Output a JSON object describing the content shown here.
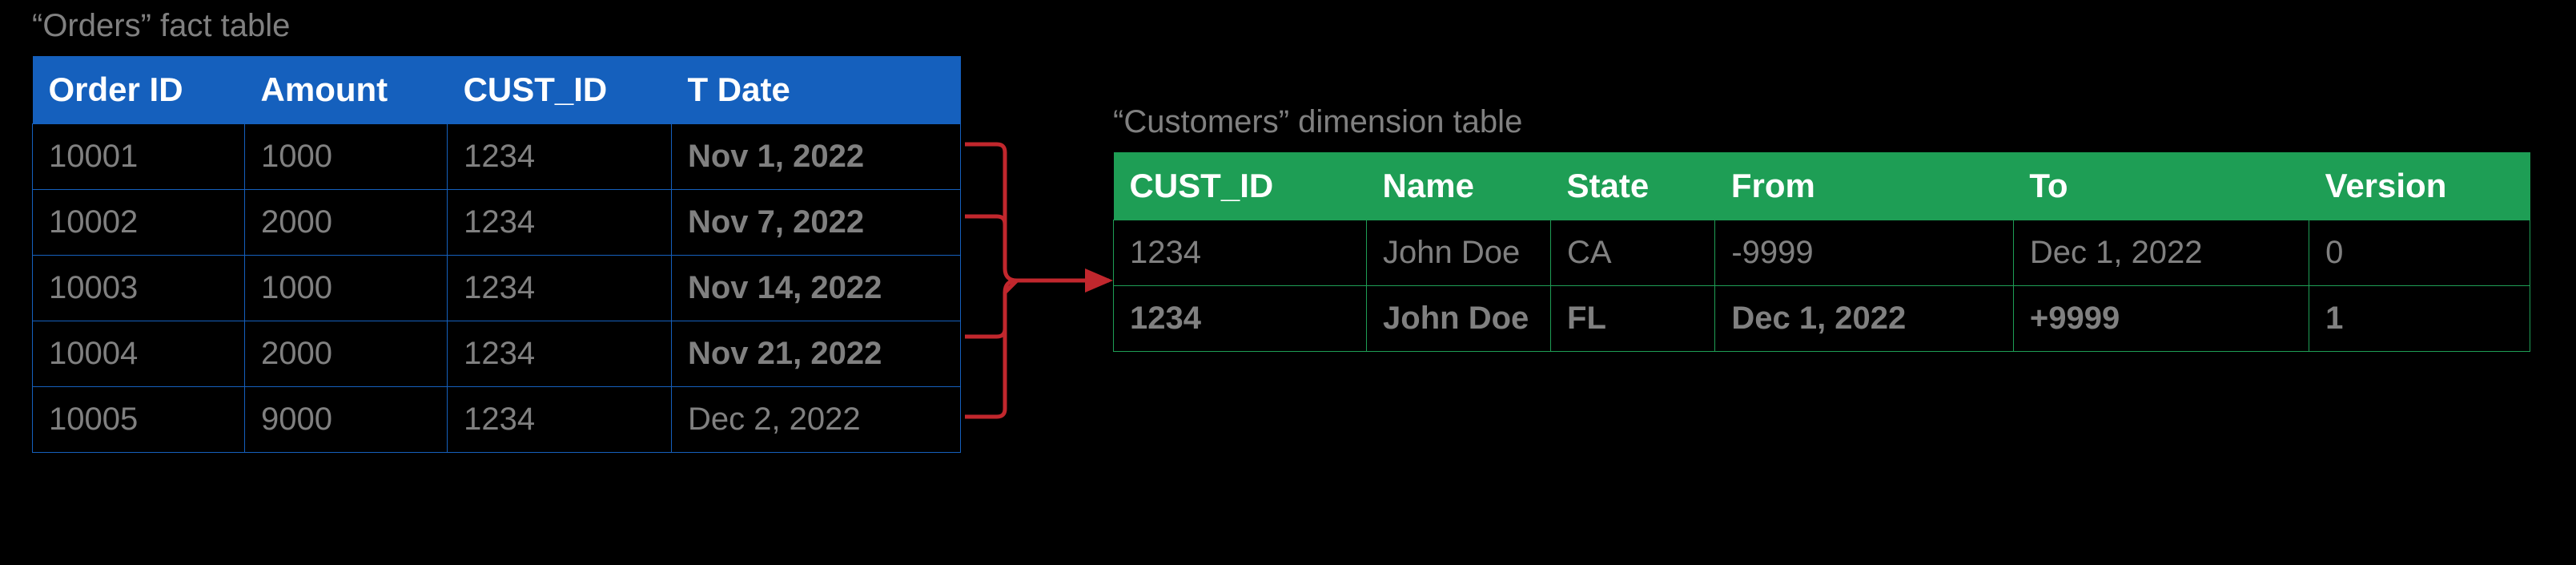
{
  "fact": {
    "caption": "“Orders” fact table",
    "columns": [
      "Order ID",
      "Amount",
      "CUST_ID",
      "T Date"
    ],
    "rows": [
      {
        "order_id": "10001",
        "amount": "1000",
        "cust_id": "1234",
        "t_date": "Nov 1, 2022",
        "date_bold": true
      },
      {
        "order_id": "10002",
        "amount": "2000",
        "cust_id": "1234",
        "t_date": "Nov 7, 2022",
        "date_bold": true
      },
      {
        "order_id": "10003",
        "amount": "1000",
        "cust_id": "1234",
        "t_date": "Nov 14, 2022",
        "date_bold": true
      },
      {
        "order_id": "10004",
        "amount": "2000",
        "cust_id": "1234",
        "t_date": "Nov 21, 2022",
        "date_bold": true
      },
      {
        "order_id": "10005",
        "amount": "9000",
        "cust_id": "1234",
        "t_date": "Dec 2, 2022",
        "date_bold": false
      }
    ]
  },
  "dim": {
    "caption": "“Customers” dimension table",
    "columns": [
      "CUST_ID",
      "Name",
      "State",
      "From",
      "To",
      "Version"
    ],
    "rows": [
      {
        "cust_id": "1234",
        "name": "John Doe",
        "state": "CA",
        "from": "-9999",
        "to": "Dec 1, 2022",
        "version": "0",
        "bold": false
      },
      {
        "cust_id": "1234",
        "name": "John Doe",
        "state": "FL",
        "from": "Dec 1, 2022",
        "to": "+9999",
        "version": "1",
        "bold": true
      }
    ]
  },
  "colors": {
    "fact_header": "#1560bd",
    "dim_header": "#1e9e55",
    "arrow": "#c1272d",
    "text_muted": "#808080",
    "bg": "#000000"
  }
}
